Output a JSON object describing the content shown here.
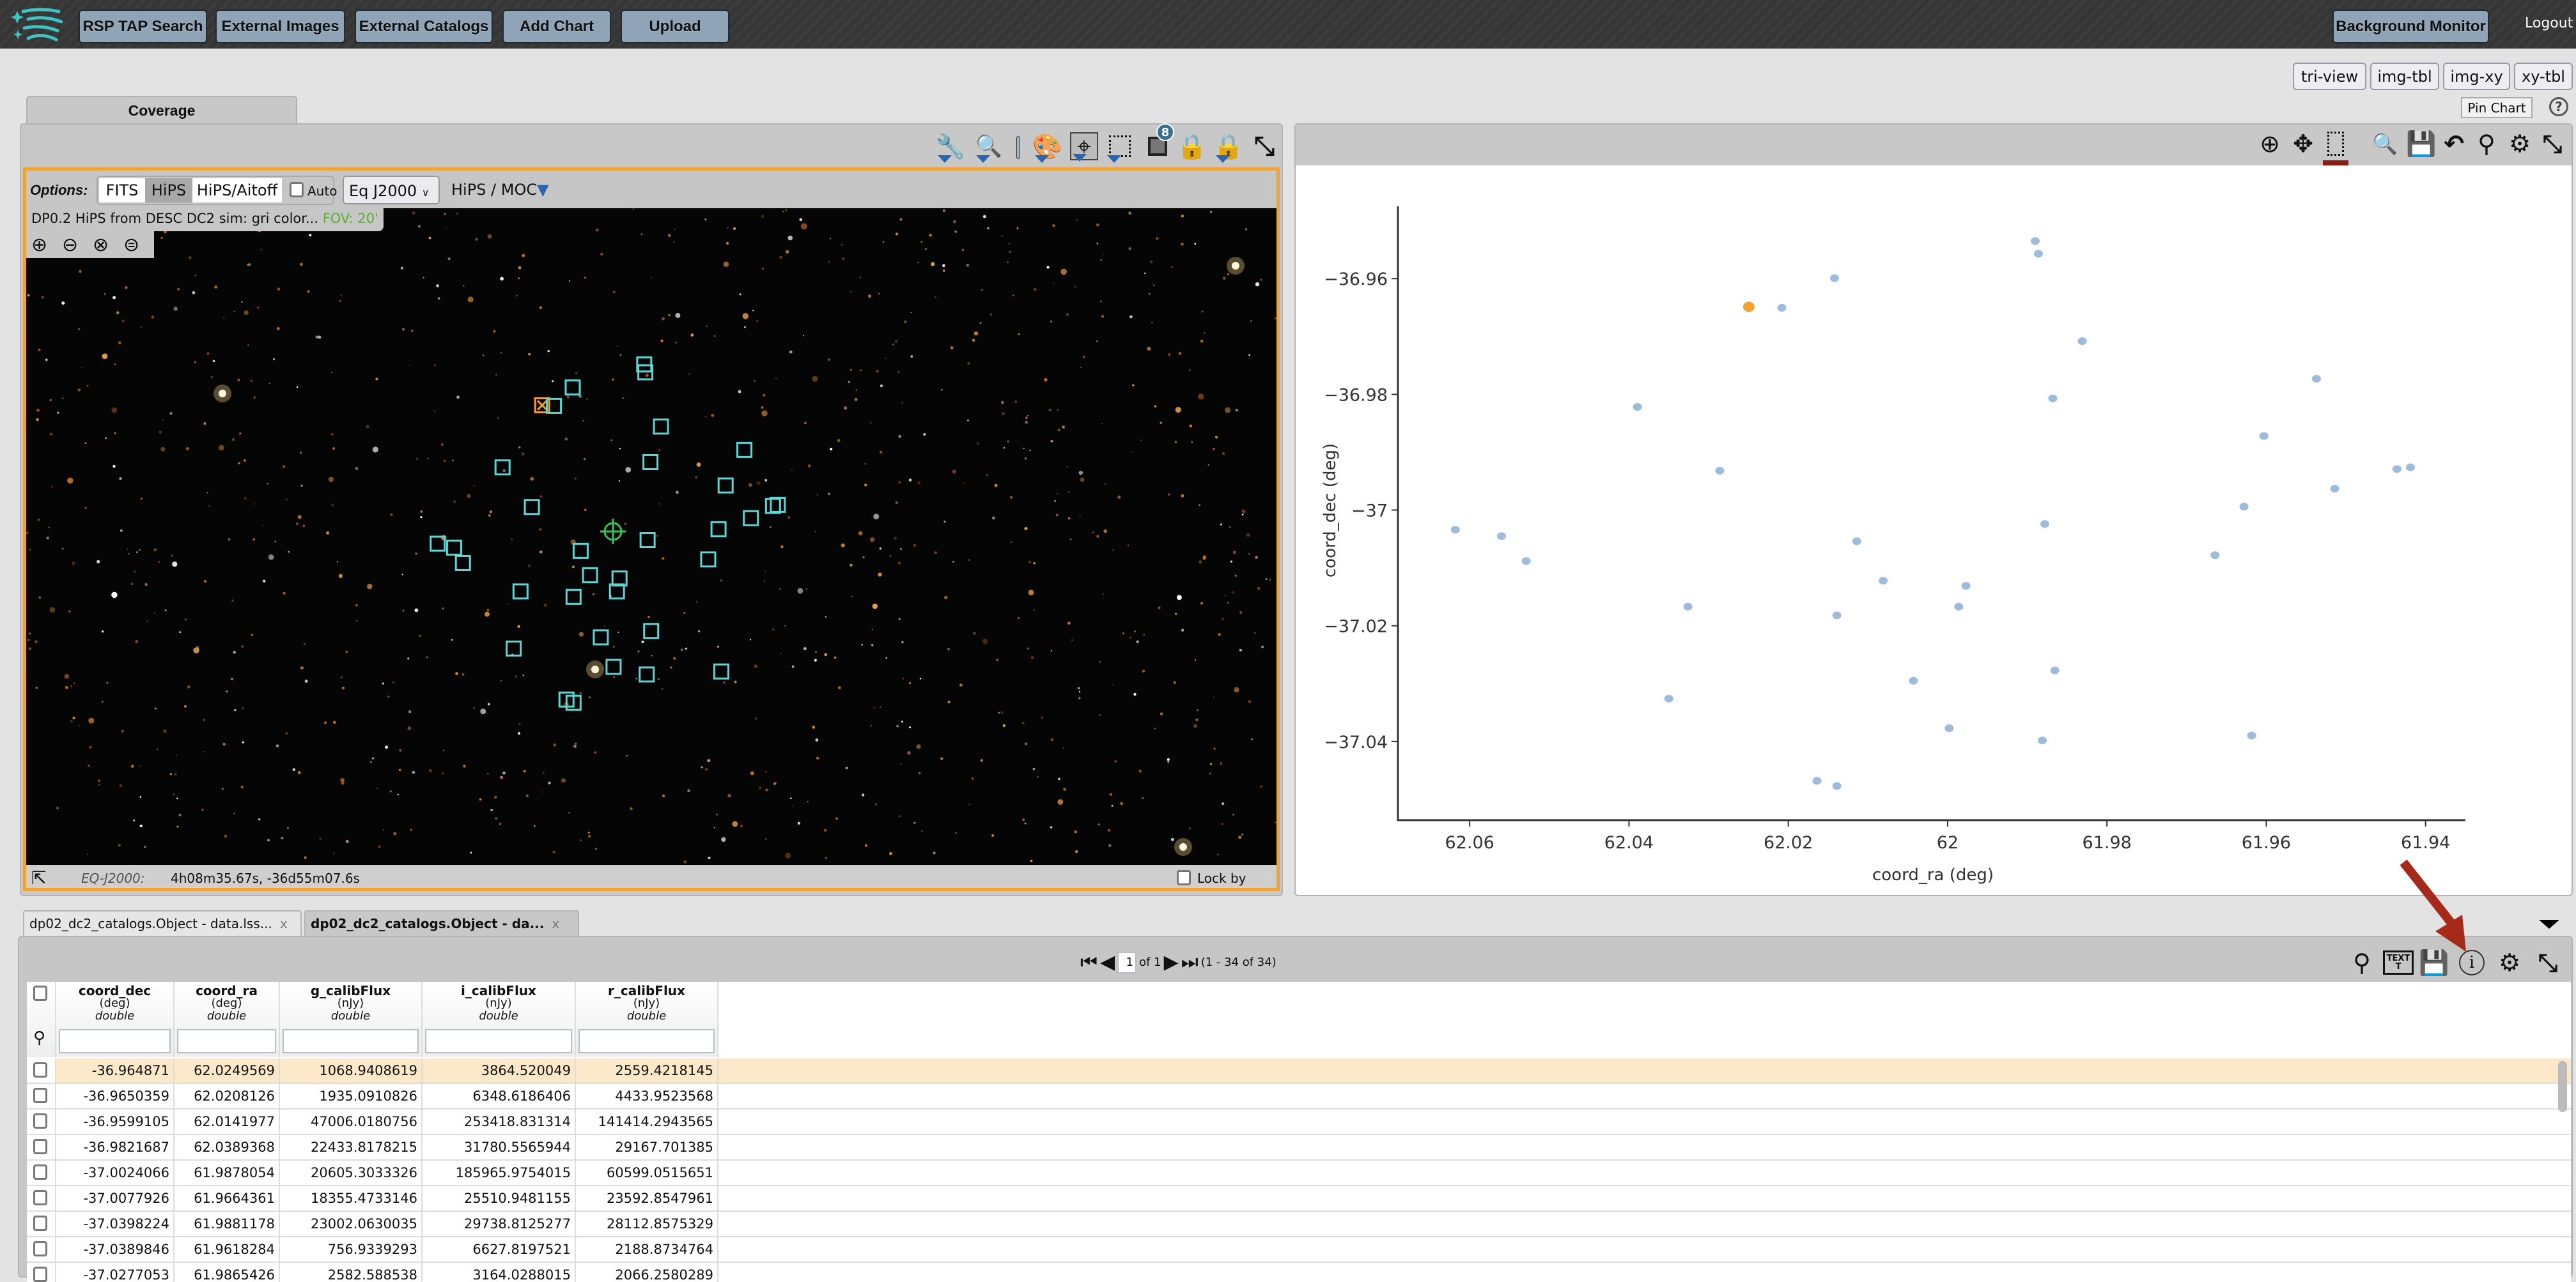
{
  "banner": {
    "logo": "rubin-firefly-logo",
    "buttons": [
      "RSP TAP Search",
      "External Images",
      "External Catalogs",
      "Add Chart",
      "Upload"
    ],
    "background_monitor": "Background Monitor",
    "logout": "Logout"
  },
  "layout_buttons": [
    "tri-view",
    "img-tbl",
    "img-xy",
    "xy-tbl"
  ],
  "pin_chart": "Pin Chart",
  "help_icon": "?",
  "image_panel": {
    "tab": "Coverage",
    "toolbar_icons": [
      "wrench-icon",
      "magnifier-icon",
      "separator",
      "palette-icon",
      "crosshair-icon",
      "select-area-icon",
      "layers-icon",
      "catalog-lock-icon",
      "image-lock-icon",
      "expand-icon"
    ],
    "layers_badge": "8",
    "options_label": "Options:",
    "projection_options": [
      "FITS",
      "HiPS",
      "HiPS/Aitoff"
    ],
    "projection_selected": "HiPS",
    "auto_label": "Auto",
    "auto_checked": false,
    "coord_system": "Eq J2000",
    "hips_moc": "HiPS / MOC",
    "hips_title": "DP0.2 HiPS from DESC DC2 sim: gri color...",
    "fov": "FOV: 20'",
    "status": {
      "coord_label": "EQ-J2000:",
      "coord_value": "4h08m35.67s, -36d55m07.6s",
      "lock_label": "Lock by click"
    },
    "marker_color": "#5fd6d6",
    "highlight_color": "#f0a232"
  },
  "chart_toolbar_icons": [
    "zoom-in-icon",
    "pan-icon",
    "select-icon",
    "zoom-1x-icon",
    "save-icon",
    "restore-icon",
    "filter-icon",
    "settings-icon",
    "expand-icon"
  ],
  "chart_data": {
    "type": "scatter",
    "xlabel": "coord_ra (deg)",
    "ylabel": "coord_dec (deg)",
    "xlim": [
      62.069,
      61.935
    ],
    "ylim": [
      -37.0536,
      -36.9475
    ],
    "x_reversed": true,
    "grid": false,
    "xticks": [
      62.06,
      62.04,
      62.02,
      62,
      61.98,
      61.96,
      61.94
    ],
    "yticks": [
      -36.96,
      -36.98,
      -37,
      -37.02,
      -37.04
    ],
    "point_color": "#9dbcdc",
    "highlight_color": "#f5a033",
    "highlighted_index": 0,
    "x": [
      62.0249569,
      62.0208126,
      62.0141977,
      62.0389368,
      62.0286,
      62.0618,
      62.056,
      62.0529,
      62.0326,
      62.035,
      62.0164,
      62.0139,
      62.0139,
      62.0114,
      62.0081,
      62.0043,
      61.9998,
      61.9986,
      61.9977,
      61.989,
      61.9886,
      61.9878054,
      61.9868,
      61.9865426,
      61.9881178,
      61.9831,
      61.9664361,
      61.9628,
      61.9618284,
      61.9603,
      61.9537,
      61.9514,
      61.9436,
      61.9419
    ],
    "y": [
      -36.964871,
      -36.9650359,
      -36.9599105,
      -36.9821687,
      -36.9932,
      -37.0034,
      -37.0045,
      -37.0088,
      -37.0167,
      -37.0326,
      -37.0468,
      -37.0477,
      -37.0182,
      -37.0054,
      -37.0122,
      -37.0295,
      -37.0377,
      -37.0167,
      -37.0131,
      -36.9535,
      -36.9557,
      -37.0024066,
      -36.9807,
      -37.0277053,
      -37.0398224,
      -36.9708,
      -37.0077926,
      -36.9994,
      -37.0389846,
      -36.9872,
      -36.9773,
      -36.9963,
      -36.9929,
      -36.9926
    ]
  },
  "tables": {
    "tabs": [
      {
        "label": "dp02_dc2_catalogs.Object - data.lss...",
        "active": false
      },
      {
        "label": "dp02_dc2_catalogs.Object - da...",
        "active": true
      }
    ],
    "close_glyph": "x",
    "pager": {
      "page": "1",
      "of": "of 1",
      "range": "(1 - 34 of 34)"
    },
    "toolbar_icons": [
      "filter-icon",
      "text-view-icon",
      "save-icon",
      "info-icon",
      "settings-icon",
      "expand-icon"
    ],
    "annotation_arrow_color": "#a52a1a",
    "columns": [
      {
        "name": "coord_dec",
        "unit": "(deg)",
        "type": "double"
      },
      {
        "name": "coord_ra",
        "unit": "(deg)",
        "type": "double"
      },
      {
        "name": "g_calibFlux",
        "unit": "(nJy)",
        "type": "double"
      },
      {
        "name": "i_calibFlux",
        "unit": "(nJy)",
        "type": "double"
      },
      {
        "name": "r_calibFlux",
        "unit": "(nJy)",
        "type": "double"
      }
    ],
    "rows": [
      [
        "-36.964871",
        "62.0249569",
        "1068.9408619",
        "3864.520049",
        "2559.4218145"
      ],
      [
        "-36.9650359",
        "62.0208126",
        "1935.0910826",
        "6348.6186406",
        "4433.9523568"
      ],
      [
        "-36.9599105",
        "62.0141977",
        "47006.0180756",
        "253418.831314",
        "141414.2943565"
      ],
      [
        "-36.9821687",
        "62.0389368",
        "22433.8178215",
        "31780.5565944",
        "29167.701385"
      ],
      [
        "-37.0024066",
        "61.9878054",
        "20605.3033326",
        "185965.9754015",
        "60599.0515651"
      ],
      [
        "-37.0077926",
        "61.9664361",
        "18355.4733146",
        "25510.9481155",
        "23592.8547961"
      ],
      [
        "-37.0398224",
        "61.9881178",
        "23002.0630035",
        "29738.8125277",
        "28112.8575329"
      ],
      [
        "-37.0389846",
        "61.9618284",
        "756.9339293",
        "6627.8197521",
        "2188.8734764"
      ],
      [
        "-37.0277053",
        "61.9865426",
        "2582.588538",
        "3164.0288015",
        "2066.2580289"
      ]
    ],
    "highlighted_row": 0
  }
}
